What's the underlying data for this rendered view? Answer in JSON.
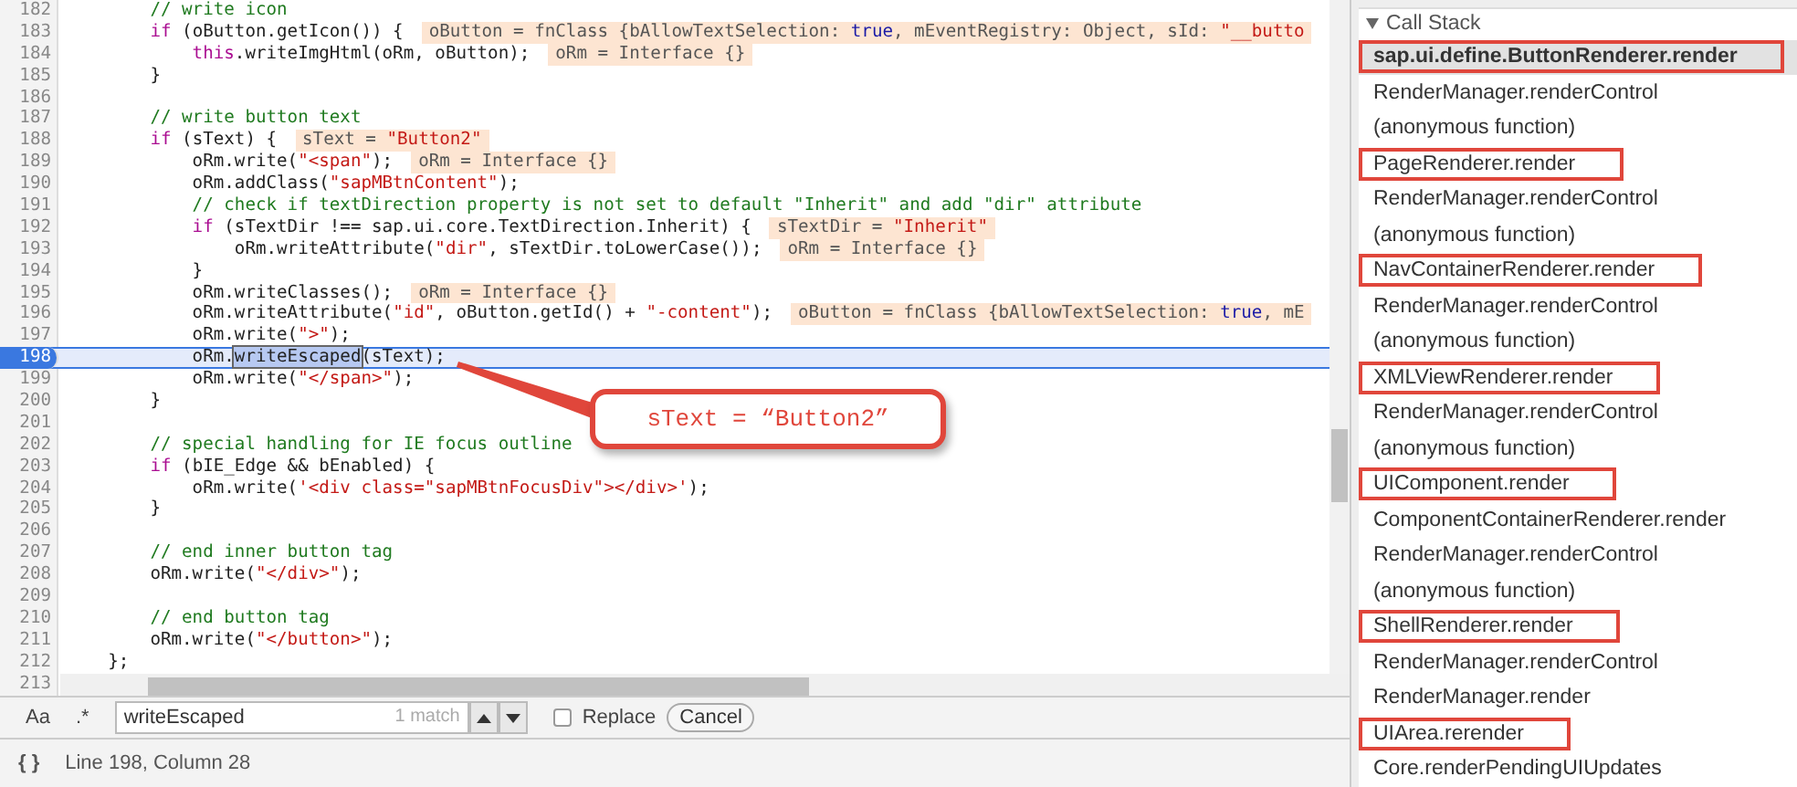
{
  "editor": {
    "lines": [
      {
        "number": "182",
        "selected": false,
        "segments": [
          {
            "kind": "comment",
            "text": "        // write icon"
          }
        ]
      },
      {
        "number": "183",
        "selected": false,
        "segments": [
          {
            "kind": "keyword",
            "text": "        if"
          },
          {
            "kind": "plain",
            "text": " (oButton.getIcon()) {"
          }
        ],
        "annotation": [
          {
            "kind": "plain",
            "text": "oButton = fnClass {bAllowTextSelection: "
          },
          {
            "kind": "bool",
            "text": "true"
          },
          {
            "kind": "plain",
            "text": ", mEventRegistry: Object, sId: "
          },
          {
            "kind": "string",
            "text": "\"__butto"
          }
        ]
      },
      {
        "number": "184",
        "selected": false,
        "segments": [
          {
            "kind": "keyword",
            "text": "            this"
          },
          {
            "kind": "plain",
            "text": ".writeImgHtml(oRm, oButton);"
          }
        ],
        "annotation": [
          {
            "kind": "plain",
            "text": "oRm = Interface {}"
          }
        ]
      },
      {
        "number": "185",
        "selected": false,
        "segments": [
          {
            "kind": "plain",
            "text": "        }"
          }
        ]
      },
      {
        "number": "186",
        "selected": false
      },
      {
        "number": "187",
        "selected": false,
        "segments": [
          {
            "kind": "comment",
            "text": "        // write button text"
          }
        ]
      },
      {
        "number": "188",
        "selected": false,
        "segments": [
          {
            "kind": "keyword",
            "text": "        if"
          },
          {
            "kind": "plain",
            "text": " (sText) {"
          }
        ],
        "annotation": [
          {
            "kind": "plain",
            "text": "sText = "
          },
          {
            "kind": "string",
            "text": "\"Button2\""
          }
        ]
      },
      {
        "number": "189",
        "selected": false,
        "segments": [
          {
            "kind": "plain",
            "text": "            oRm.write("
          },
          {
            "kind": "string",
            "text": "\"<span\""
          },
          {
            "kind": "plain",
            "text": ");"
          }
        ],
        "annotation": [
          {
            "kind": "plain",
            "text": "oRm = Interface {}"
          }
        ]
      },
      {
        "number": "190",
        "selected": false,
        "segments": [
          {
            "kind": "plain",
            "text": "            oRm.addClass("
          },
          {
            "kind": "string",
            "text": "\"sapMBtnContent\""
          },
          {
            "kind": "plain",
            "text": ");"
          }
        ]
      },
      {
        "number": "191",
        "selected": false,
        "segments": [
          {
            "kind": "comment",
            "text": "            // check if textDirection property is not set to default \"Inherit\" and add \"dir\" attribute"
          }
        ]
      },
      {
        "number": "192",
        "selected": false,
        "segments": [
          {
            "kind": "keyword",
            "text": "            if"
          },
          {
            "kind": "plain",
            "text": " (sTextDir !== sap.ui.core.TextDirection.Inherit) {"
          }
        ],
        "annotation": [
          {
            "kind": "plain",
            "text": "sTextDir = "
          },
          {
            "kind": "string",
            "text": "\"Inherit\""
          }
        ]
      },
      {
        "number": "193",
        "selected": false,
        "segments": [
          {
            "kind": "plain",
            "text": "                oRm.writeAttribute("
          },
          {
            "kind": "string",
            "text": "\"dir\""
          },
          {
            "kind": "plain",
            "text": ", sTextDir.toLowerCase());"
          }
        ],
        "annotation": [
          {
            "kind": "plain",
            "text": "oRm = Interface {}"
          }
        ]
      },
      {
        "number": "194",
        "selected": false,
        "segments": [
          {
            "kind": "plain",
            "text": "            }"
          }
        ]
      },
      {
        "number": "195",
        "selected": false,
        "segments": [
          {
            "kind": "plain",
            "text": "            oRm.writeClasses();"
          }
        ],
        "annotation": [
          {
            "kind": "plain",
            "text": "oRm = Interface {}"
          }
        ]
      },
      {
        "number": "196",
        "selected": false,
        "segments": [
          {
            "kind": "plain",
            "text": "            oRm.writeAttribute("
          },
          {
            "kind": "string",
            "text": "\"id\""
          },
          {
            "kind": "plain",
            "text": ", oButton.getId() + "
          },
          {
            "kind": "string",
            "text": "\"-content\""
          },
          {
            "kind": "plain",
            "text": ");"
          }
        ],
        "annotation": [
          {
            "kind": "plain",
            "text": "oButton = fnClass {bAllowTextSelection: "
          },
          {
            "kind": "bool",
            "text": "true"
          },
          {
            "kind": "plain",
            "text": ", mE"
          }
        ]
      },
      {
        "number": "197",
        "selected": false,
        "segments": [
          {
            "kind": "plain",
            "text": "            oRm.write("
          },
          {
            "kind": "string",
            "text": "\">\""
          },
          {
            "kind": "plain",
            "text": ");"
          }
        ]
      },
      {
        "number": "198",
        "selected": true,
        "segments": [
          {
            "kind": "plain",
            "text": "            oRm."
          },
          {
            "kind": "match",
            "text": "writeEscaped"
          },
          {
            "kind": "plain",
            "text": "(sText);"
          }
        ]
      },
      {
        "number": "199",
        "selected": false,
        "segments": [
          {
            "kind": "plain",
            "text": "            oRm.write("
          },
          {
            "kind": "string",
            "text": "\"</span>\""
          },
          {
            "kind": "plain",
            "text": ");"
          }
        ]
      },
      {
        "number": "200",
        "selected": false,
        "segments": [
          {
            "kind": "plain",
            "text": "        }"
          }
        ]
      },
      {
        "number": "201",
        "selected": false
      },
      {
        "number": "202",
        "selected": false,
        "segments": [
          {
            "kind": "comment",
            "text": "        // special handling for IE focus outline"
          }
        ]
      },
      {
        "number": "203",
        "selected": false,
        "segments": [
          {
            "kind": "keyword",
            "text": "        if"
          },
          {
            "kind": "plain",
            "text": " (bIE_Edge && bEnabled) {"
          }
        ]
      },
      {
        "number": "204",
        "selected": false,
        "segments": [
          {
            "kind": "plain",
            "text": "            oRm.write("
          },
          {
            "kind": "string",
            "text": "'<div class=\"sapMBtnFocusDiv\"></div>'"
          },
          {
            "kind": "plain",
            "text": ");"
          }
        ]
      },
      {
        "number": "205",
        "selected": false,
        "segments": [
          {
            "kind": "plain",
            "text": "        }"
          }
        ]
      },
      {
        "number": "206",
        "selected": false
      },
      {
        "number": "207",
        "selected": false,
        "segments": [
          {
            "kind": "comment",
            "text": "        // end inner button tag"
          }
        ]
      },
      {
        "number": "208",
        "selected": false,
        "segments": [
          {
            "kind": "plain",
            "text": "        oRm.write("
          },
          {
            "kind": "string",
            "text": "\"</div>\""
          },
          {
            "kind": "plain",
            "text": ");"
          }
        ]
      },
      {
        "number": "209",
        "selected": false
      },
      {
        "number": "210",
        "selected": false,
        "segments": [
          {
            "kind": "comment",
            "text": "        // end button tag"
          }
        ]
      },
      {
        "number": "211",
        "selected": false,
        "segments": [
          {
            "kind": "plain",
            "text": "        oRm.write("
          },
          {
            "kind": "string",
            "text": "\"</button>\""
          },
          {
            "kind": "plain",
            "text": ");"
          }
        ]
      },
      {
        "number": "212",
        "selected": false,
        "segments": [
          {
            "kind": "plain",
            "text": "    };"
          }
        ]
      },
      {
        "number": "213",
        "selected": false
      }
    ],
    "callout": {
      "text": "sText = “Button2”"
    }
  },
  "search": {
    "case_toggle": "Aa",
    "regex_toggle": ".*",
    "query": "writeEscaped",
    "match_count": "1 match",
    "replace_checked": false,
    "replace_label": "Replace",
    "cancel": "Cancel"
  },
  "status_bar": {
    "braces": "{ }",
    "position": "Line 198, Column 28"
  },
  "call_stack": {
    "title": "Call Stack",
    "expanded": true,
    "frames": [
      {
        "name": "sap.ui.define.ButtonRenderer.render",
        "selected": true,
        "boxed": true
      },
      {
        "name": "RenderManager.renderControl",
        "selected": false,
        "boxed": false
      },
      {
        "name": "(anonymous function)",
        "selected": false,
        "boxed": false
      },
      {
        "name": "PageRenderer.render",
        "selected": false,
        "boxed": true
      },
      {
        "name": "RenderManager.renderControl",
        "selected": false,
        "boxed": false
      },
      {
        "name": "(anonymous function)",
        "selected": false,
        "boxed": false
      },
      {
        "name": "NavContainerRenderer.render",
        "selected": false,
        "boxed": true
      },
      {
        "name": "RenderManager.renderControl",
        "selected": false,
        "boxed": false
      },
      {
        "name": "(anonymous function)",
        "selected": false,
        "boxed": false
      },
      {
        "name": "XMLViewRenderer.render",
        "selected": false,
        "boxed": true
      },
      {
        "name": "RenderManager.renderControl",
        "selected": false,
        "boxed": false
      },
      {
        "name": "(anonymous function)",
        "selected": false,
        "boxed": false
      },
      {
        "name": "UIComponent.render",
        "selected": false,
        "boxed": true
      },
      {
        "name": "ComponentContainerRenderer.render",
        "selected": false,
        "boxed": false
      },
      {
        "name": "RenderManager.renderControl",
        "selected": false,
        "boxed": false
      },
      {
        "name": "(anonymous function)",
        "selected": false,
        "boxed": false
      },
      {
        "name": "ShellRenderer.render",
        "selected": false,
        "boxed": true
      },
      {
        "name": "RenderManager.renderControl",
        "selected": false,
        "boxed": false
      },
      {
        "name": "RenderManager.render",
        "selected": false,
        "boxed": false
      },
      {
        "name": "UIArea.rerender",
        "selected": false,
        "boxed": true
      },
      {
        "name": "Core.renderPendingUIUpdates",
        "selected": false,
        "boxed": false
      }
    ]
  }
}
